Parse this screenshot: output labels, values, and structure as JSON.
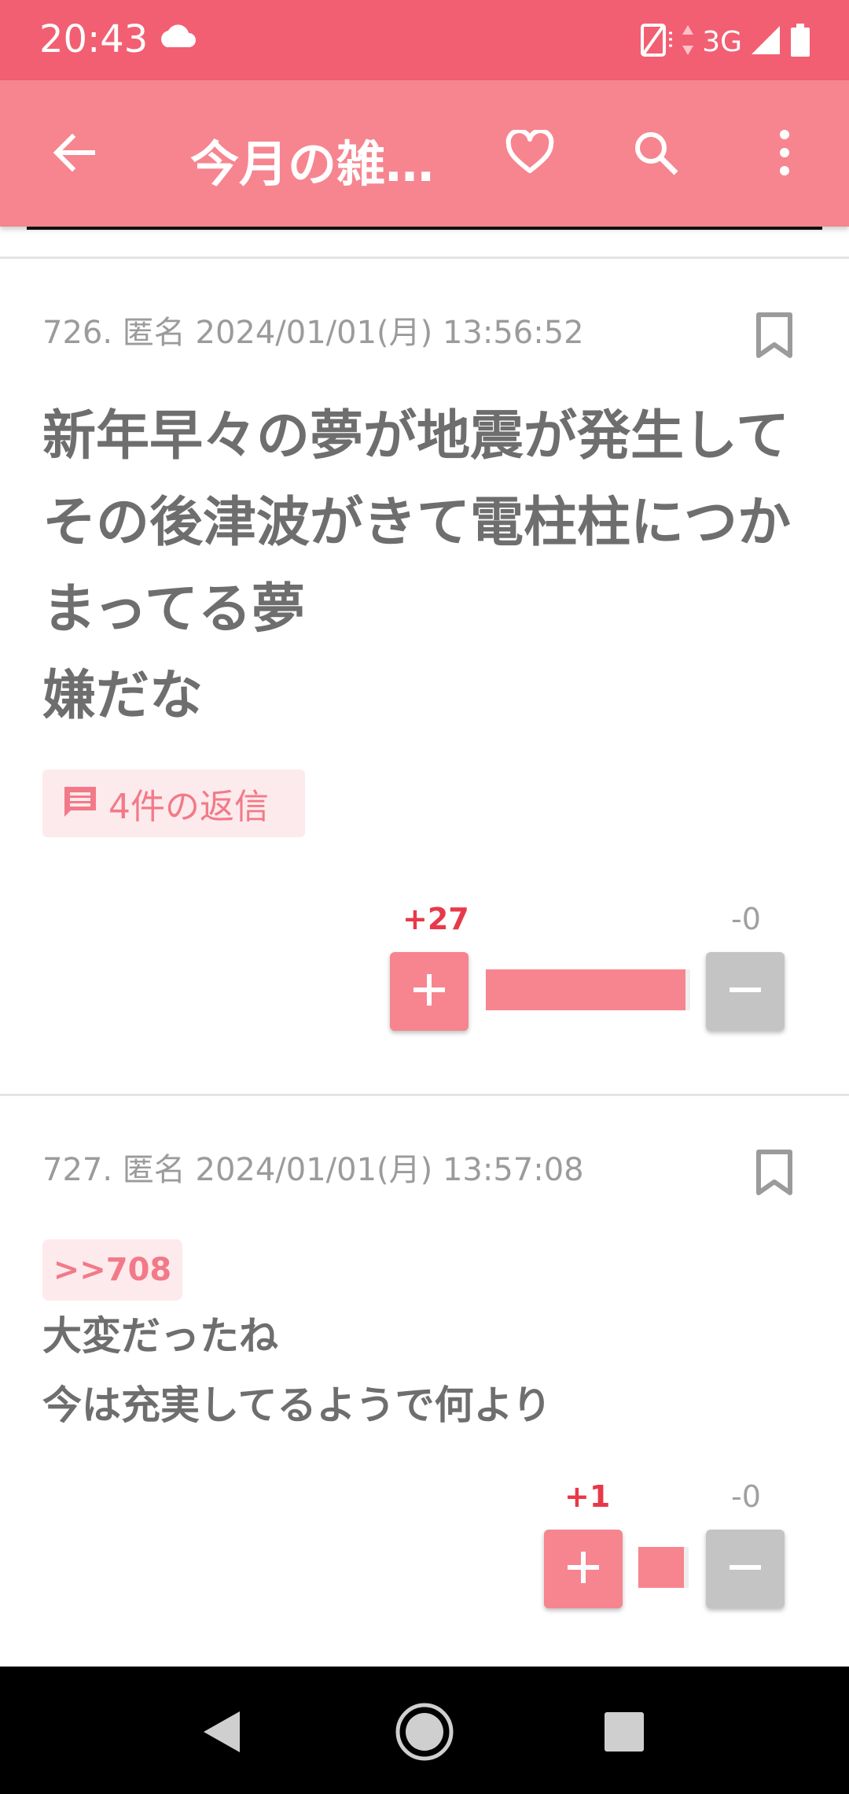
{
  "status": {
    "time": "20:43",
    "network": "3G"
  },
  "appbar": {
    "title": "今月の雑…"
  },
  "posts": [
    {
      "meta": "726. 匿名 2024/01/01(月) 13:56:52",
      "body_lines": [
        "新年早々の夢が地震が発生して",
        "その後津波がきて電柱柱につか",
        "まってる夢",
        "嫌だな"
      ],
      "replies_label": "4件の返信",
      "plus_score": "+27",
      "minus_score": "-0",
      "plus_fraction": 1.0
    },
    {
      "meta": "727. 匿名 2024/01/01(月) 13:57:08",
      "anchor": ">>708",
      "body_lines": [
        "大変だったね",
        "今は充実してるようで何より"
      ],
      "plus_score": "+1",
      "minus_score": "-0",
      "plus_fraction": 1.0
    }
  ],
  "colors": {
    "status_bar": "#f25f72",
    "app_bar": "#f6858f",
    "plus_score": "#e8394a",
    "bar_fill": "#f6858f"
  }
}
